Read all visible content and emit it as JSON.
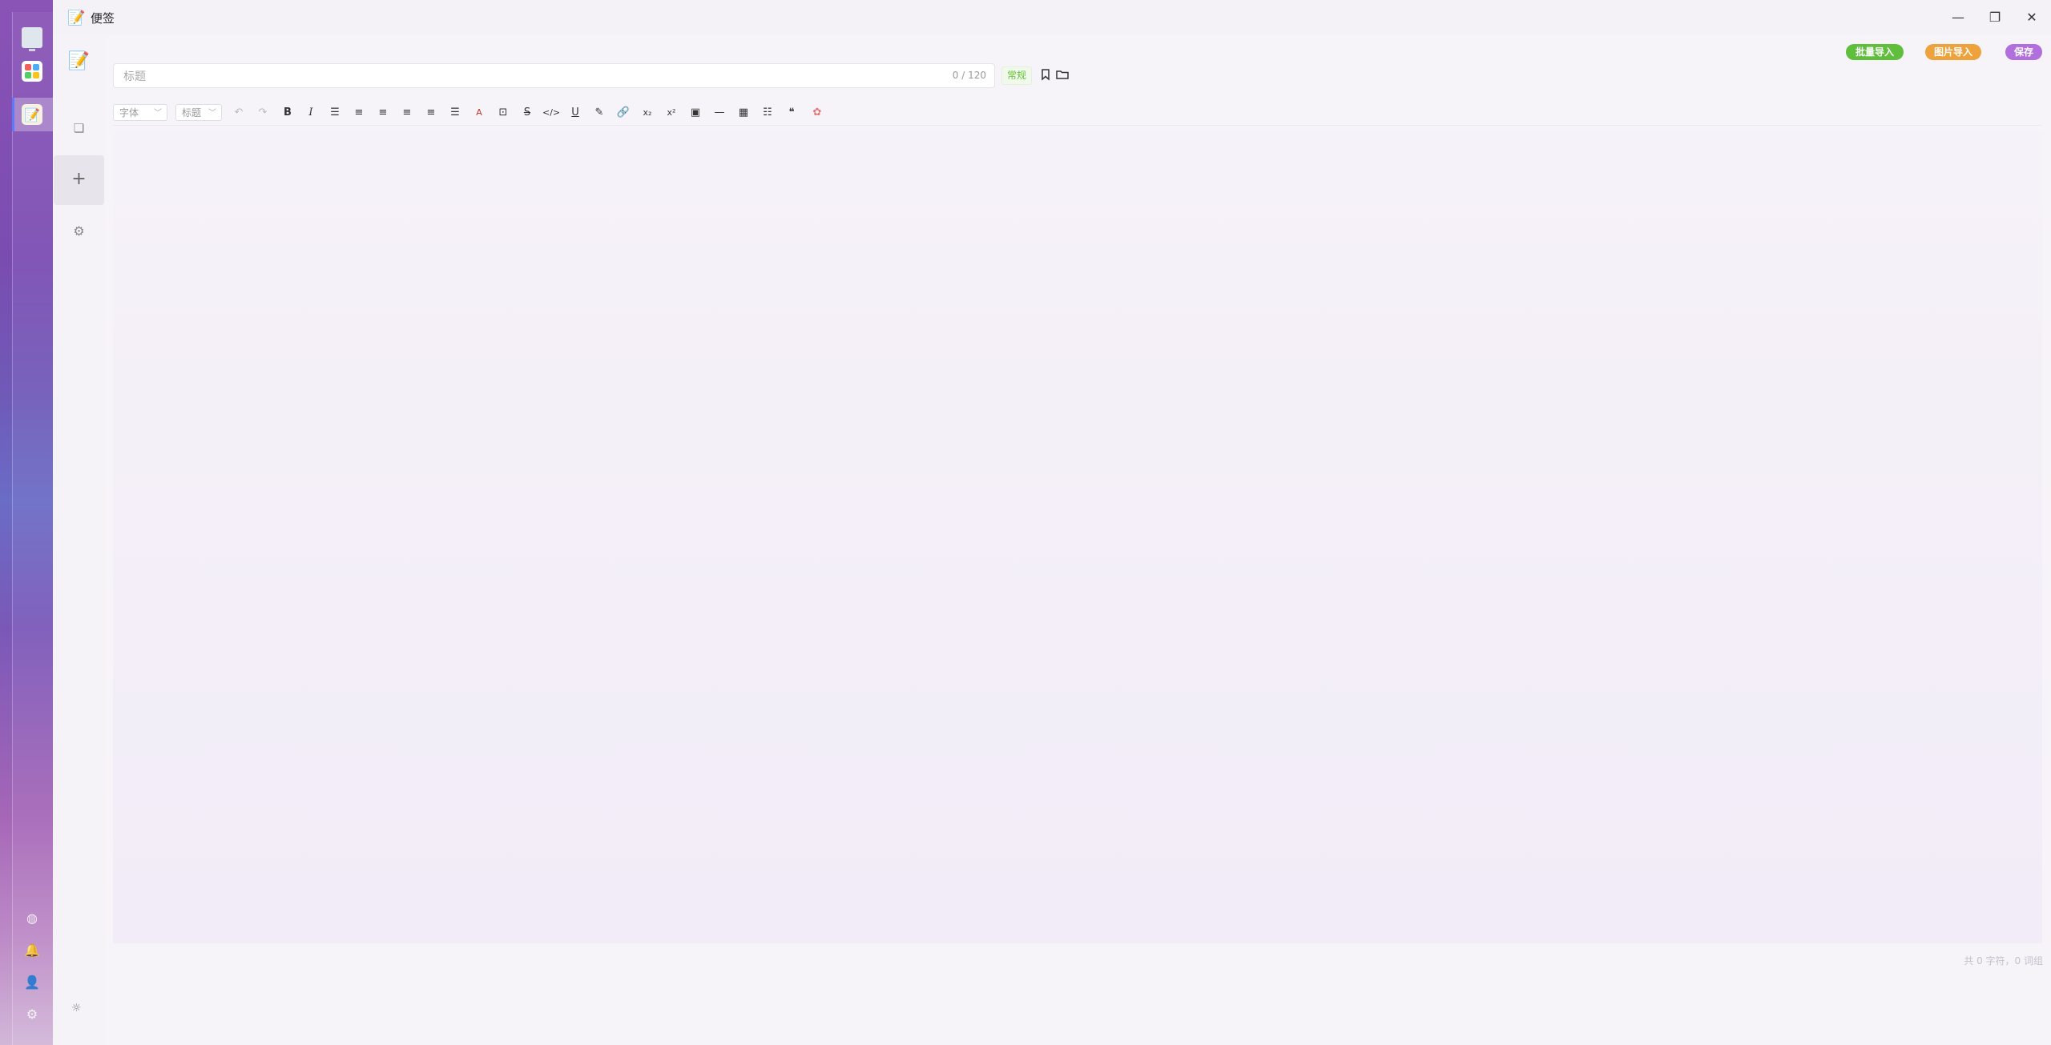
{
  "window": {
    "title": "便签",
    "minimize_glyph": "—",
    "restore_glyph": "❐",
    "close_glyph": "✕"
  },
  "dock": {
    "apps": [
      "monitor-icon",
      "apps-icon",
      "notes-icon"
    ],
    "bottom": [
      "sync-icon",
      "bell-icon",
      "user-icon",
      "gear-icon"
    ]
  },
  "sidebar": {
    "items": [
      "notes-logo-icon",
      "copy-icon",
      "add-icon",
      "settings-icon",
      "sun-icon"
    ]
  },
  "actions": {
    "batch_import": "批量导入",
    "image_import": "图片导入",
    "save": "保存"
  },
  "editor": {
    "title_placeholder": "标题",
    "title_counter": "0 / 120",
    "category_tag": "常规",
    "font_select": "字体",
    "heading_select": "标题",
    "status": "共 0 字符，0 词组"
  },
  "colors": {
    "batch": "#5fbf3c",
    "image": "#eea23b",
    "save": "#b06fdc",
    "tag": "#67c23a"
  }
}
